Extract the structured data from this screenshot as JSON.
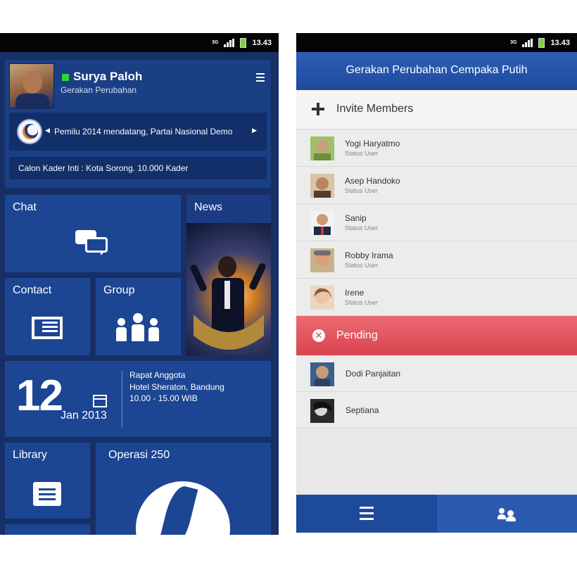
{
  "status_bar": {
    "time": "13.43",
    "network": "3G"
  },
  "left_screen": {
    "profile": {
      "name": "Surya Paloh",
      "organization": "Gerakan Perubahan",
      "online_color": "#2fd33a"
    },
    "news_ticker": "Pemilu 2014 mendatang, Partai Nasional Demo",
    "kader_info": "Calon Kader Inti : Kota Sorong. 10.000 Kader",
    "tiles": {
      "chat": "Chat",
      "news": "News",
      "contact": "Contact",
      "group": "Group",
      "library": "Library",
      "operasi": "Operasi 250"
    },
    "event": {
      "day": "12",
      "month_year": "Jan 2013",
      "title": "Rapat Anggota",
      "place": "Hotel Sheraton, Bandung",
      "time": "10.00 - 15.00 WIB"
    },
    "colors": {
      "background": "#162f66",
      "tile": "#1c4693"
    }
  },
  "right_screen": {
    "title": "Gerakan Perubahan Cempaka Putih",
    "invite_label": "Invite Members",
    "members": [
      {
        "name": "Yogi Haryatmo",
        "status": "Status User"
      },
      {
        "name": "Asep Handoko",
        "status": "Status User"
      },
      {
        "name": "Sanip",
        "status": "Status User"
      },
      {
        "name": "Robby Irama",
        "status": "Status User"
      },
      {
        "name": "Irene",
        "status": "Status User"
      }
    ],
    "pending_label": "Pending",
    "pending_members": [
      {
        "name": "Dodi Panjaitan"
      },
      {
        "name": "Septiana"
      }
    ],
    "colors": {
      "header": "#2d5fb8",
      "pending": "#e05560"
    }
  }
}
